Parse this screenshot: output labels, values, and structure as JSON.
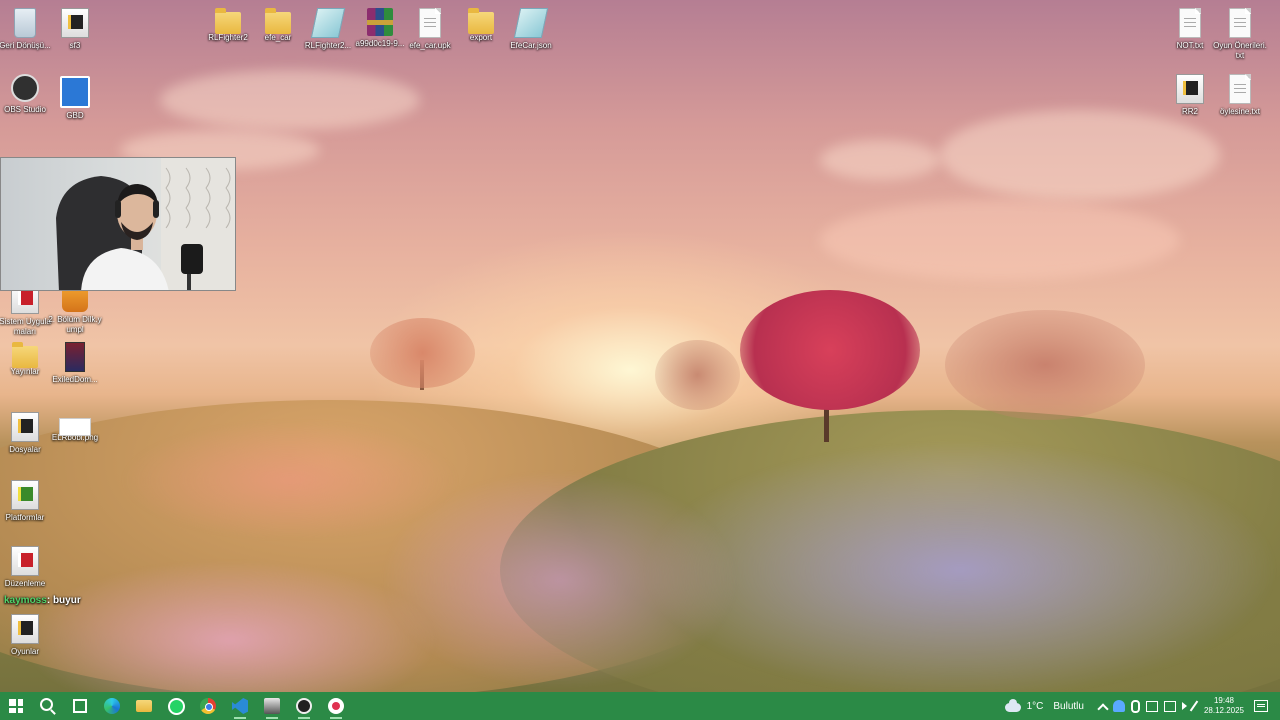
{
  "desktop": {
    "icons_left": [
      {
        "id": "recycle-bin",
        "label": "Geri Dönüşü...",
        "glyph": "bin"
      },
      {
        "id": "sf3",
        "label": "sf3",
        "glyph": "shortcut"
      },
      {
        "id": "obs-studio",
        "label": "OBS Studio",
        "glyph": "obs"
      },
      {
        "id": "gbd",
        "label": "GBD",
        "glyph": "app"
      },
      {
        "id": "sistem-uygulamalari",
        "label": "Sistem Uygulamaları",
        "glyph": "red"
      },
      {
        "id": "2-bolum",
        "label": "2. Bölüm Dilk.yumpl",
        "glyph": "orange"
      },
      {
        "id": "yayinlar",
        "label": "Yayınlar",
        "glyph": "folder"
      },
      {
        "id": "exiled",
        "label": "ExiledDom...",
        "glyph": "book"
      },
      {
        "id": "dosyalar",
        "label": "Dosyalar",
        "glyph": "shortcut"
      },
      {
        "id": "elrbobi",
        "label": "ELRbobi.png",
        "glyph": "white"
      },
      {
        "id": "platformlar",
        "label": "Platformlar",
        "glyph": "green"
      },
      {
        "id": "duzenleme",
        "label": "Düzenleme",
        "glyph": "red"
      },
      {
        "id": "oyunlar",
        "label": "Oyunlar",
        "glyph": "shortcut"
      }
    ],
    "icons_top": [
      {
        "id": "rlfighter2",
        "label": "RLFighter2",
        "glyph": "folder"
      },
      {
        "id": "efe-car",
        "label": "efe_car",
        "glyph": "folder"
      },
      {
        "id": "rlfighter2-json",
        "label": "RLFighter2...",
        "glyph": "json"
      },
      {
        "id": "a99d",
        "label": "a99d0c19-9...",
        "glyph": "rar"
      },
      {
        "id": "efe-car-upk",
        "label": "efe_car.upk",
        "glyph": "file"
      },
      {
        "id": "export",
        "label": "export",
        "glyph": "folder"
      },
      {
        "id": "efecar-json",
        "label": "EfeCar.json",
        "glyph": "json"
      }
    ],
    "icons_right": [
      {
        "id": "not-txt",
        "label": "NOT.txt",
        "glyph": "file"
      },
      {
        "id": "oyun-onerileri",
        "label": "Oyun Önerileri.txt",
        "glyph": "file"
      },
      {
        "id": "rr2",
        "label": "RR2",
        "glyph": "shortcut"
      },
      {
        "id": "oylesine",
        "label": "öylesine.txt",
        "glyph": "file"
      }
    ]
  },
  "chat": {
    "user": "kaymoss",
    "separator": ":",
    "message": "buyur"
  },
  "taskbar": {
    "apps": [
      {
        "id": "start",
        "icon": "windows-icon"
      },
      {
        "id": "search",
        "icon": "search-icon"
      },
      {
        "id": "task-view",
        "icon": "task-view-icon"
      },
      {
        "id": "edge",
        "icon": "edge-icon"
      },
      {
        "id": "file-explorer",
        "icon": "folder-icon"
      },
      {
        "id": "whatsapp",
        "icon": "whatsapp-icon"
      },
      {
        "id": "chrome",
        "icon": "chrome-icon"
      },
      {
        "id": "vscode",
        "icon": "vscode-icon"
      },
      {
        "id": "app-window",
        "icon": "app-icon"
      },
      {
        "id": "obs",
        "icon": "obs-icon"
      },
      {
        "id": "recorder",
        "icon": "record-icon"
      }
    ],
    "weather": {
      "temp": "1°C",
      "condition": "Bulutlu"
    },
    "clock": {
      "time": "19:48",
      "date": "28.12.2025"
    }
  }
}
